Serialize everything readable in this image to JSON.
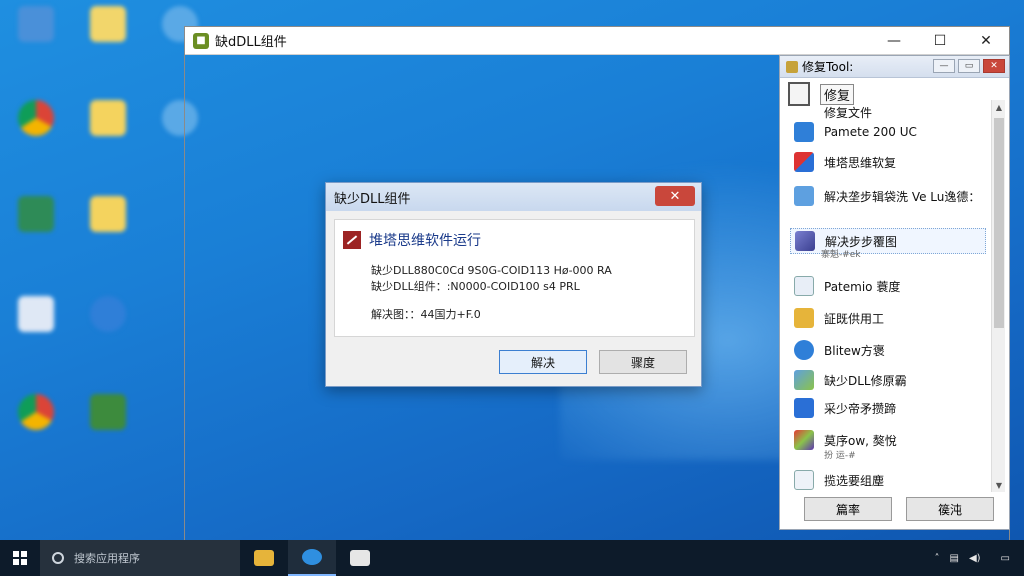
{
  "window": {
    "title": "缺dDLL组件",
    "controls": {
      "minimize": "—",
      "maximize": "☐",
      "close": "✕"
    }
  },
  "dialog": {
    "title": "缺少DLL组件",
    "close_glyph": "✕",
    "heading": "堆塔思维软件运行",
    "lines": [
      "缺少DLL880C0Cd 9S0G-COID113 Hø-000 RA",
      "缺少DLL组件：:N0000-COID100 s4 PRL",
      "解决图：：44国力+F.0"
    ],
    "buttons": {
      "primary": "解决",
      "secondary": "骤度"
    }
  },
  "tool": {
    "title": "修复Tool:",
    "controls": {
      "min": "—",
      "max": "▭",
      "close": "✕"
    },
    "header_label": "修复",
    "items": [
      {
        "label": "修复文件",
        "sub": ""
      },
      {
        "label": "Pamete 200 UC",
        "sub": ""
      },
      {
        "label": "堆塔思维软复",
        "sub": ""
      },
      {
        "label": "解决垄步辑袋洗  Ve Lu逸德：",
        "sub": ""
      },
      {
        "label": "解决步步覆图",
        "sub": "寨魁-#ek"
      },
      {
        "label": "Patemio 蓑度",
        "sub": ""
      },
      {
        "label": "証既供用工",
        "sub": ""
      },
      {
        "label": "Blitew方褒",
        "sub": ""
      },
      {
        "label": "缺少DLL修原霸",
        "sub": ""
      },
      {
        "label": "采少帝矛攒蹄",
        "sub": ""
      },
      {
        "label": "莫序ow, 獒悅",
        "sub": "扮 运-#"
      },
      {
        "label": "揽选要组塵",
        "sub": ""
      }
    ],
    "buttons": {
      "left": "篇率",
      "right": "篌沌"
    }
  },
  "taskbar": {
    "search_placeholder": "搜索应用程序"
  },
  "colors": {
    "desktop": "#1a7fd6",
    "dialog_title": "#c8d8ee",
    "close_red": "#c9473b",
    "heading_blue": "#1a3a8a"
  }
}
